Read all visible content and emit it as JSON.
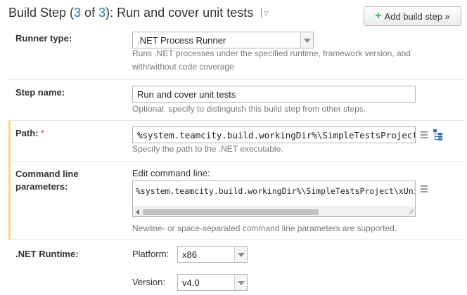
{
  "header": {
    "title_prefix": "Build Step (",
    "step_current": "3",
    "title_of": " of ",
    "step_total": "3",
    "title_suffix": "): Run and cover unit tests",
    "menu_icon": "chevron-down-icon",
    "add_button_label": "Add build step »"
  },
  "runner": {
    "label": "Runner type:",
    "value": ".NET Process Runner",
    "hint": "Runs .NET processes under the specified runtime, framework version, and with/without code coverage"
  },
  "step_name": {
    "label": "Step name:",
    "value": "Run and cover unit tests",
    "hint": "Optional, specify to distinguish this build step from other steps."
  },
  "path": {
    "label": "Path:",
    "required_mark": "*",
    "value": "%system.teamcity.build.workingDir%\\SimpleTestsProject\\pa",
    "hint": "Specify the path to the .NET executable.",
    "icons": [
      "list-icon",
      "tree-icon"
    ]
  },
  "cmdline": {
    "label_line1": "Command line",
    "label_line2": "parameters:",
    "edit_label": "Edit command line:",
    "value": "%system.teamcity.build.workingDir%\\SimpleTestsProject\\xUnitTe",
    "hint": "Newline- or space-separated command line parameters are supported."
  },
  "runtime": {
    "label": ".NET Runtime:",
    "platform_label": "Platform:",
    "platform_value": "x86",
    "version_label": "Version:",
    "version_value": "v4.0"
  },
  "colors": {
    "accent_link": "#1a73c6",
    "required_bar": "#f9d968",
    "plus_green": "#3cac45",
    "required_star": "#e0352b"
  }
}
